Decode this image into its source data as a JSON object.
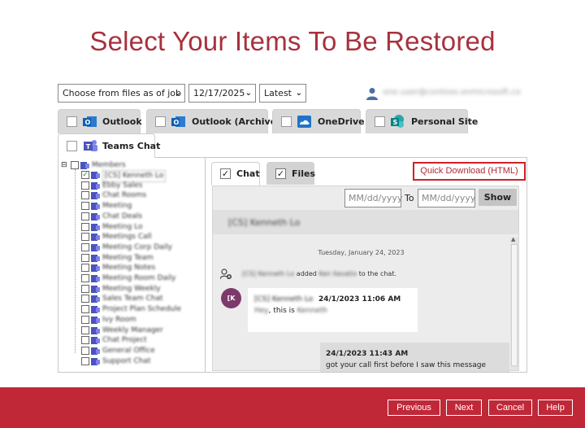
{
  "page": {
    "title": "Select Your Items To Be Restored"
  },
  "filters": {
    "job_label": "Choose from files as of job",
    "date": "12/17/2025",
    "version": "Latest"
  },
  "user": {
    "name": "one.user@contoso.onmicrosoft.com"
  },
  "source_tabs": [
    {
      "label": "Outlook",
      "icon": "outlook-icon"
    },
    {
      "label": "Outlook (Archive)",
      "icon": "outlook-icon"
    },
    {
      "label": "OneDrive",
      "icon": "onedrive-icon"
    },
    {
      "label": "Personal Site",
      "icon": "sharepoint-icon"
    },
    {
      "label": "Teams Chat",
      "icon": "teams-icon"
    }
  ],
  "tree": {
    "root": "Members",
    "items": [
      "[CS] Kenneth Lo",
      "Ebby Sales",
      "Chat Rooms",
      "Meeting",
      "Chat Deals",
      "Meeting Lo",
      "Meetings Call",
      "Meeting Corp Daily",
      "Meeting Team",
      "Meeting Notes",
      "Meeting Room Daily",
      "Meeting Weekly",
      "Sales Team Chat",
      "Project Plan Schedule",
      "Ivy Room",
      "Weekly Manager",
      "Chat Project",
      "General Office",
      "Support Chat"
    ]
  },
  "detail": {
    "tabs": {
      "chat": "Chat",
      "files": "Files"
    },
    "quick_download": "Quick Download (HTML)",
    "from_placeholder": "MM/dd/yyyy",
    "to_label": "To",
    "to_placeholder": "MM/dd/yyyy",
    "show_label": "Show",
    "chat_title": "[CS] Kenneth Lo",
    "day": "Tuesday, January 24, 2023",
    "system": {
      "actor": "[CS] Kenneth Lo",
      "verb": "added",
      "target": "Ken Ilavatio",
      "suffix": "to the chat."
    },
    "msg1": {
      "avatar": "[K",
      "sender": "[CS] Kenneth Lo",
      "time": "24/1/2023 11:06 AM",
      "pre": "Hey",
      "text": ", this is",
      "post": "Kenneth"
    },
    "msg2": {
      "time": "24/1/2023 11:43 AM",
      "text": "got your call first before I saw this message"
    }
  },
  "footer": {
    "previous": "Previous",
    "next": "Next",
    "cancel": "Cancel",
    "help": "Help"
  }
}
